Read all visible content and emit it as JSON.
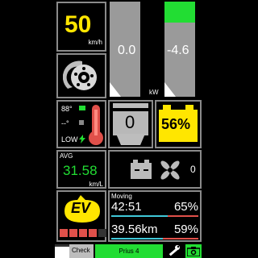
{
  "colors": {
    "accent_yellow": "#ffe600",
    "accent_green": "#22dd33",
    "bar_gray": "#9a9a9a",
    "border_gray": "#8a8a8a",
    "track_red": "#e0504a",
    "track_cyan": "#40c8d8"
  },
  "speed": {
    "value": "50",
    "unit": "km/h"
  },
  "power": {
    "left_value": "0.0",
    "right_value": "-4.6",
    "unit": "kW",
    "right_green_level": 0.22
  },
  "temperature": {
    "top_value": "88°",
    "mid_value": "--°",
    "low_label": "LOW"
  },
  "engine": {
    "value": "0"
  },
  "battery": {
    "percent": "56%"
  },
  "average": {
    "label": "AVG",
    "value": "31.58",
    "unit": "km/L"
  },
  "auxiliary": {
    "fan_value": "0"
  },
  "ev": {
    "badge": "EV",
    "segments": 5,
    "segments_green": 4
  },
  "moving": {
    "label": "Moving",
    "time": "42:51",
    "time_percent": "65%",
    "time_fraction": 0.65,
    "distance": "39.56km",
    "distance_percent": "59%",
    "distance_fraction": 0.59
  },
  "bottom_bar": {
    "check_label": "Check",
    "vehicle_label": "Prius 4"
  },
  "icons": [
    "brake-disc-icon",
    "thermometer-icon",
    "bolt-icon",
    "engine-icon",
    "battery-icon",
    "fan-icon",
    "wrench-icon",
    "camera-icon"
  ]
}
